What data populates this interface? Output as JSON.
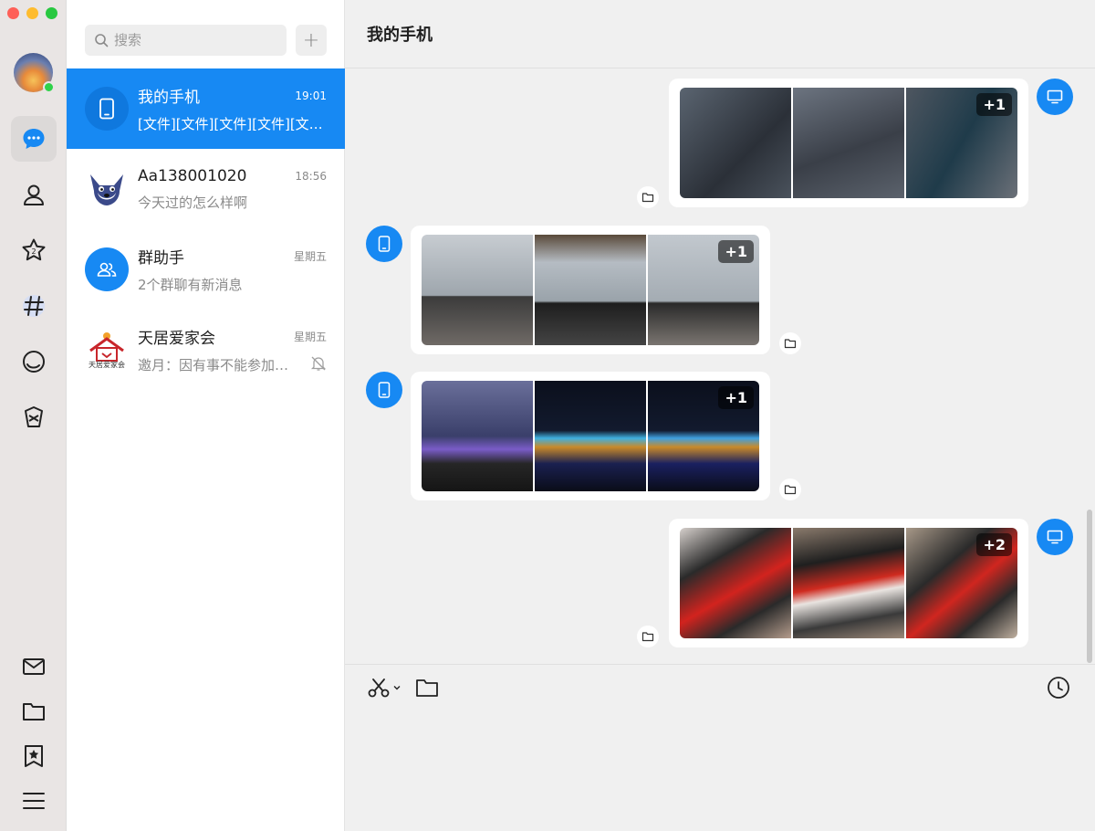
{
  "window": {
    "title": "我的手机"
  },
  "search": {
    "placeholder": "搜索"
  },
  "add_button": {
    "label": "+"
  },
  "conversations": [
    {
      "name": "我的手机",
      "time": "19:01",
      "last_message": "[文件][文件][文件][文件][文件]",
      "active": true
    },
    {
      "name": "Aa138001020",
      "time": "18:56",
      "last_message": "今天过的怎么样啊"
    },
    {
      "name": "群助手",
      "time": "星期五",
      "last_message": "2个群聊有新消息"
    },
    {
      "name": "天居爱家会",
      "time": "星期五",
      "last_message": "邀月：因有事不能参加，请假一次",
      "muted": true,
      "avatar_text": "天居爱家会"
    }
  ],
  "chat": {
    "title": "我的手机",
    "messages": [
      {
        "sender": "desktop",
        "more_count": "+1"
      },
      {
        "sender": "phone",
        "more_count": "+1"
      },
      {
        "sender": "phone",
        "more_count": "+1"
      },
      {
        "sender": "desktop",
        "more_count": "+2"
      }
    ]
  },
  "colors": {
    "accent": "#1789f3",
    "rail_bg": "#e9e5e4",
    "chat_bg": "#f0f0f0",
    "online": "#2fd24a"
  }
}
